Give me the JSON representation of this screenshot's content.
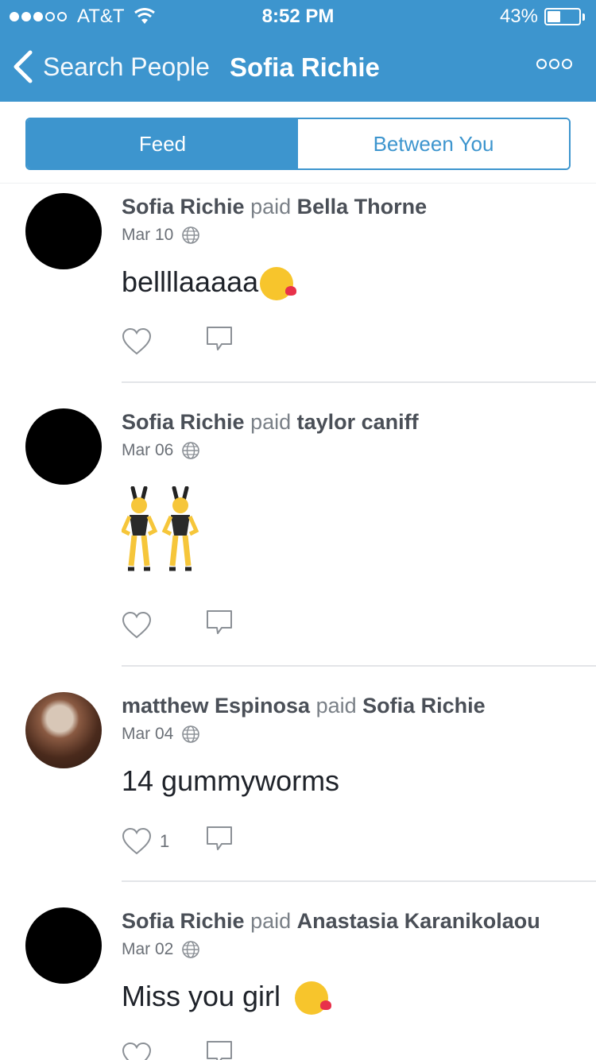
{
  "status_bar": {
    "carrier": "AT&T",
    "time": "8:52 PM",
    "battery": "43%",
    "battery_level": 0.43
  },
  "nav": {
    "back_label": "Search People",
    "title": "Sofia Richie"
  },
  "tabs": [
    {
      "label": "Feed",
      "active": true
    },
    {
      "label": "Between You",
      "active": false
    }
  ],
  "colors": {
    "brand": "#3d95ce"
  },
  "stories": [
    {
      "from": "Sofia Richie",
      "verb": "paid",
      "to": "Bella Thorne",
      "date": "Mar 10",
      "message": "bellllaaaaa",
      "emoji": "kissing-face-with-heart-emoji",
      "likes": ""
    },
    {
      "from": "Sofia Richie",
      "verb": "paid",
      "to": "taylor caniff",
      "date": "Mar 06",
      "message": "",
      "emoji": "bunny-dancers-emoji",
      "likes": ""
    },
    {
      "from": "matthew Espinosa",
      "verb": "paid",
      "to": "Sofia Richie",
      "date": "Mar 04",
      "message": "14 gummyworms",
      "emoji": "",
      "likes": "1"
    },
    {
      "from": "Sofia Richie",
      "verb": "paid",
      "to": "Anastasia Karanikolaou",
      "date": "Mar 02",
      "message": "Miss you girl",
      "emoji": "kissing-face-emoji",
      "likes": ""
    }
  ]
}
